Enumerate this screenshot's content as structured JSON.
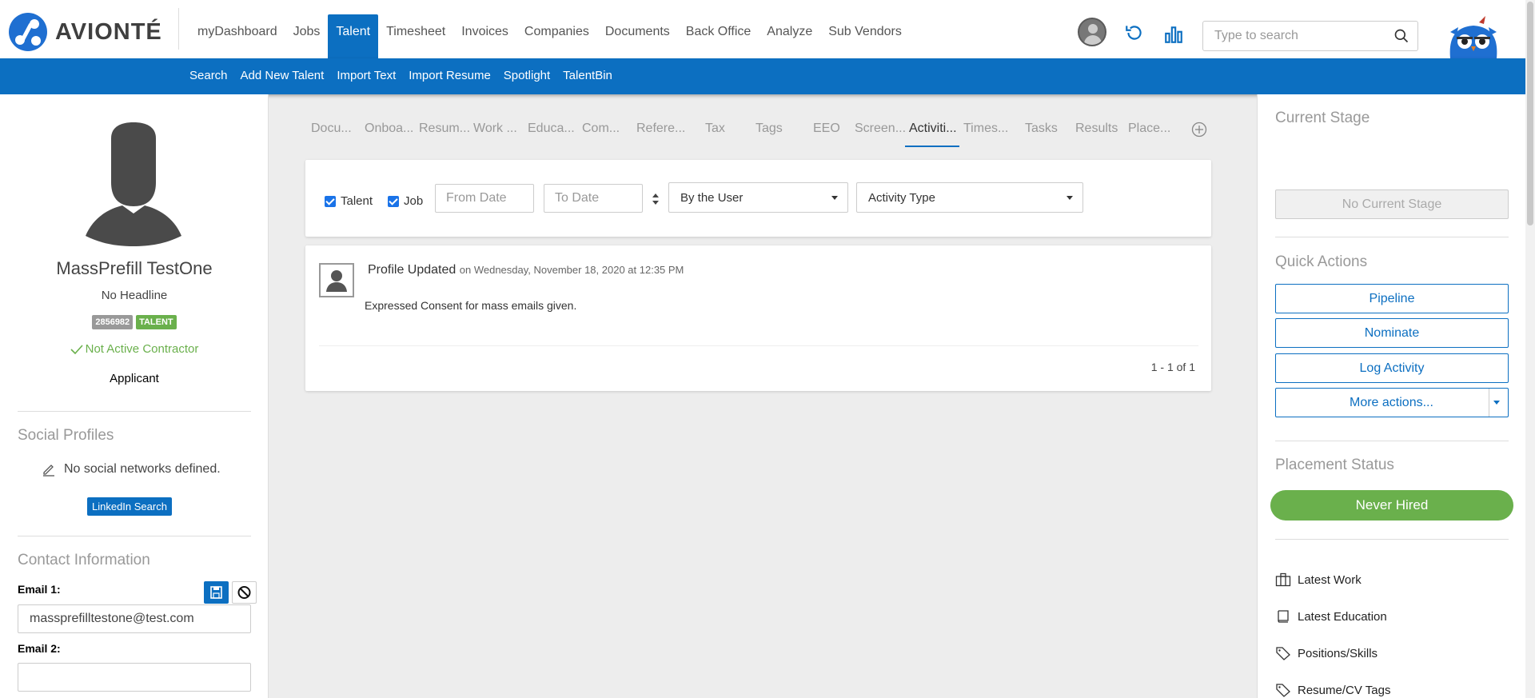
{
  "brand": {
    "name": "AVIONTÉ",
    "accent": "#0c6fc1",
    "success": "#6ab04c"
  },
  "mainnav": [
    "myDashboard",
    "Jobs",
    "Talent",
    "Timesheet",
    "Invoices",
    "Companies",
    "Documents",
    "Back Office",
    "Analyze",
    "Sub Vendors"
  ],
  "mainnav_active": "Talent",
  "search": {
    "placeholder": "Type to search"
  },
  "subnav": [
    "Search",
    "Add New Talent",
    "Import Text",
    "Import Resume",
    "Spotlight",
    "TalentBin"
  ],
  "talent": {
    "name": "MassPrefill TestOne",
    "headline": "No Headline",
    "id_badge": "2856982",
    "type_badge": "TALENT",
    "contractor_status": "Not Active Contractor",
    "status": "Applicant"
  },
  "social": {
    "title": "Social Profiles",
    "empty": "No social networks defined.",
    "linkedin_button": "LinkedIn Search"
  },
  "contact": {
    "title": "Contact Information",
    "email1_label": "Email 1:",
    "email1_value": "massprefilltestone@test.com",
    "email2_label": "Email 2:",
    "email2_value": ""
  },
  "tabs": [
    "Docu...",
    "Onboa...",
    "Resum...",
    "Work ...",
    "Educa...",
    "Com...",
    "Refere...",
    "Tax",
    "Tags",
    "EEO",
    "Screen...",
    "Activiti...",
    "Times...",
    "Tasks",
    "Results",
    "Place..."
  ],
  "tabs_active": "Activiti...",
  "filters": {
    "talent_label": "Talent",
    "job_label": "Job",
    "from_placeholder": "From Date",
    "to_placeholder": "To Date",
    "user_select": "By the User",
    "type_select": "Activity Type"
  },
  "activity": {
    "title": "Profile Updated",
    "date": "on Wednesday, November 18, 2020 at 12:35 PM",
    "text": "Expressed Consent for mass emails given.",
    "pagination": "1 - 1 of 1"
  },
  "right": {
    "current_stage_title": "Current Stage",
    "no_stage": "No Current Stage",
    "quick_actions_title": "Quick Actions",
    "pipeline": "Pipeline",
    "nominate": "Nominate",
    "log_activity": "Log Activity",
    "more_actions": "More actions...",
    "placement_title": "Placement Status",
    "placement_status": "Never Hired",
    "links": [
      "Latest Work",
      "Latest Education",
      "Positions/Skills",
      "Resume/CV Tags"
    ]
  }
}
